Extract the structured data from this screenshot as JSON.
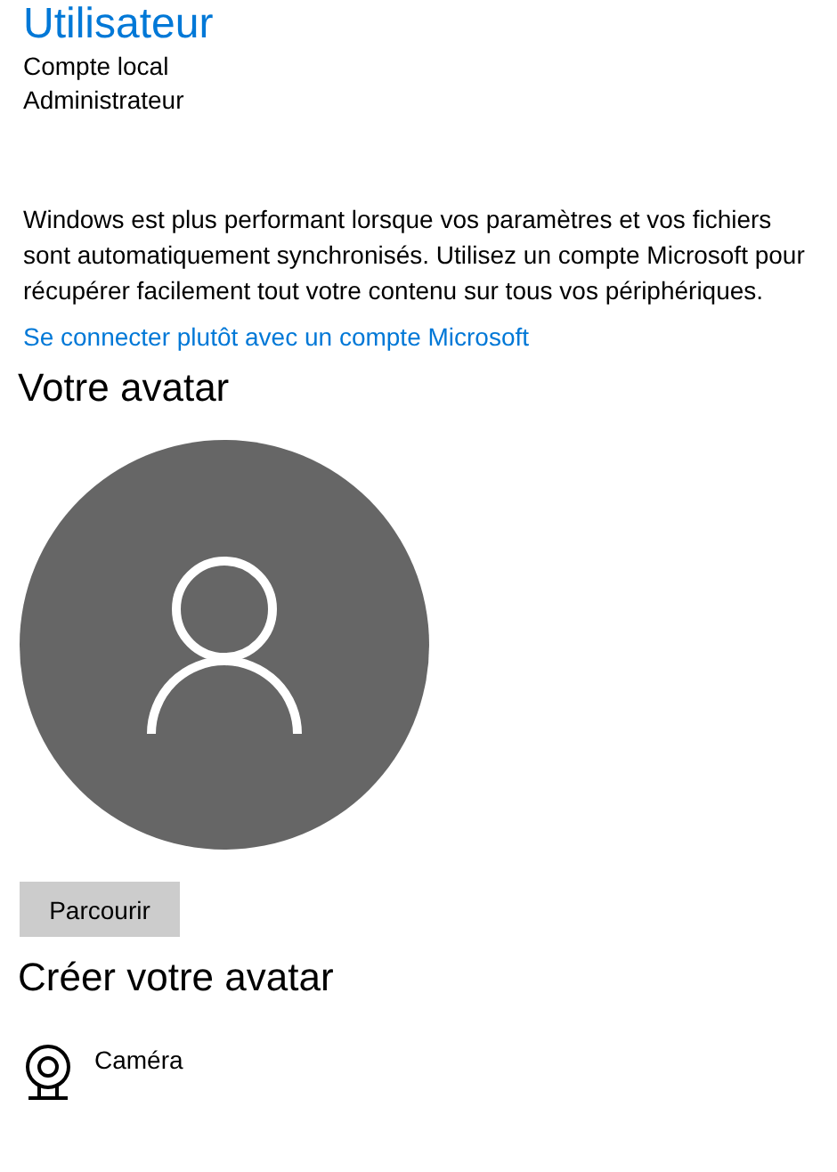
{
  "account": {
    "name": "Utilisateur",
    "type": "Compte local",
    "role": "Administrateur"
  },
  "sync_message": "Windows est plus performant lorsque vos paramètres et vos fichiers sont automatiquement synchronisés. Utilisez un compte Microsoft pour récupérer facilement tout votre contenu sur tous vos périphériques.",
  "signin_link": "Se connecter plutôt avec un compte Microsoft",
  "avatar_section": {
    "title": "Votre avatar",
    "browse_button": "Parcourir"
  },
  "create_section": {
    "title": "Créer votre avatar",
    "options": [
      {
        "kind": "camera",
        "label": "Caméra"
      }
    ]
  }
}
